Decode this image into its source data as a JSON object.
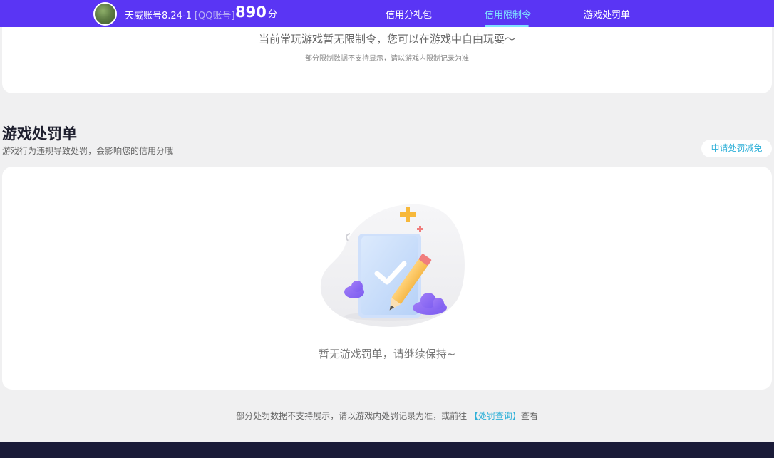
{
  "header": {
    "account_name": "天威账号8.24-1",
    "account_type": "[QQ账号]",
    "score": "890",
    "score_unit": "分",
    "tabs": [
      {
        "label": "信用分礼包",
        "active": false
      },
      {
        "label": "信用限制令",
        "active": true
      },
      {
        "label": "游戏处罚单",
        "active": false
      }
    ]
  },
  "restriction": {
    "message": "当前常玩游戏暂无限制令，您可以在游戏中自由玩耍～",
    "note": "部分限制数据不支持显示，请以游戏内限制记录为准"
  },
  "penalty": {
    "title": "游戏处罚单",
    "subtitle": "游戏行为违规导致处罚，会影响您的信用分哦",
    "apply_button": "申请处罚减免",
    "empty_message": "暂无游戏罚单，请继续保持~"
  },
  "footer": {
    "note_prefix": "部分处罚数据不支持展示，请以游戏内处罚记录为准，或前往",
    "link_label": "【处罚查询】",
    "note_suffix": "查看"
  },
  "colors": {
    "header_bg": "#5a35f4",
    "active_tab": "#7fe0ff",
    "link": "#2fb0d8",
    "page_bg": "#f0f0f1",
    "bottom_band": "#1a1b38"
  },
  "icons": {
    "avatar": "landscape-avatar",
    "illustration": "empty-clipboard-pencil-illustration"
  }
}
